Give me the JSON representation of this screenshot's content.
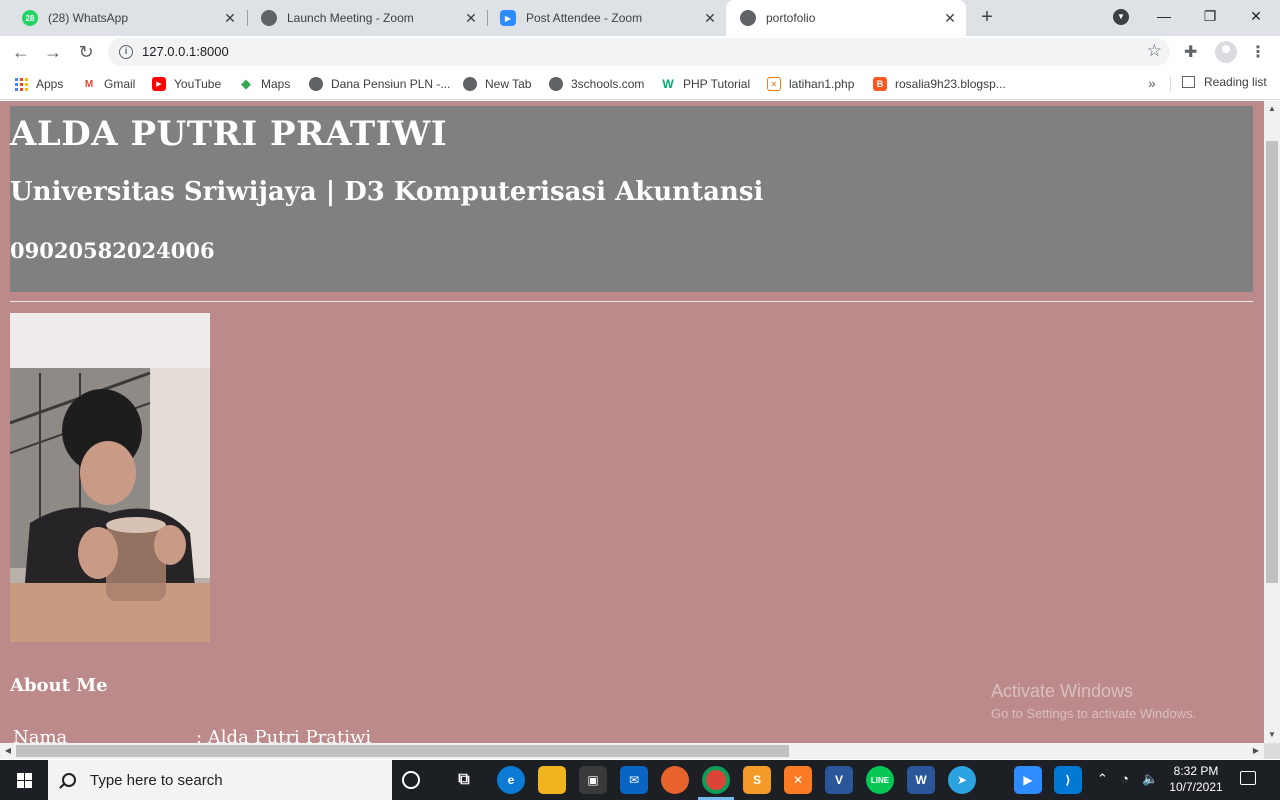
{
  "browser": {
    "tabs": [
      {
        "title": "(28) WhatsApp",
        "badge": "28",
        "icon": "whatsapp-icon"
      },
      {
        "title": "Launch Meeting - Zoom",
        "icon": "globe-icon"
      },
      {
        "title": "Post Attendee - Zoom",
        "icon": "zoom-icon"
      },
      {
        "title": "portofolio",
        "icon": "globe-icon",
        "active": true
      }
    ],
    "url": "127.0.0.1:8000",
    "bookmarks": [
      {
        "label": "Apps",
        "icon": "apps-grid-icon"
      },
      {
        "label": "Gmail",
        "icon": "gmail-icon"
      },
      {
        "label": "YouTube",
        "icon": "youtube-icon"
      },
      {
        "label": "Maps",
        "icon": "maps-icon"
      },
      {
        "label": "Dana Pensiun PLN -...",
        "icon": "globe-icon"
      },
      {
        "label": "New Tab",
        "icon": "globe-icon"
      },
      {
        "label": "3schools.com",
        "icon": "globe-icon"
      },
      {
        "label": "PHP Tutorial",
        "icon": "w3-icon"
      },
      {
        "label": "latihan1.php",
        "icon": "xampp-icon"
      },
      {
        "label": "rosalia9h23.blogsp...",
        "icon": "blogger-icon"
      }
    ],
    "reading_list": "Reading list"
  },
  "page": {
    "name": "ALDA PUTRI PRATIWI",
    "subtitle": "Universitas Sriwijaya | D3 Komputerisasi Akuntansi",
    "student_id": "09020582024006",
    "about_title": "About Me",
    "about_rows": [
      {
        "label": "Nama",
        "value": ": Alda Putri Pratiwi"
      }
    ],
    "colors": {
      "background": "#bc8a8a",
      "header": "#808080"
    }
  },
  "watermark": {
    "title": "Activate Windows",
    "subtitle": "Go to Settings to activate Windows."
  },
  "taskbar": {
    "search_placeholder": "Type here to search",
    "time": "8:32 PM",
    "date": "10/7/2021"
  }
}
